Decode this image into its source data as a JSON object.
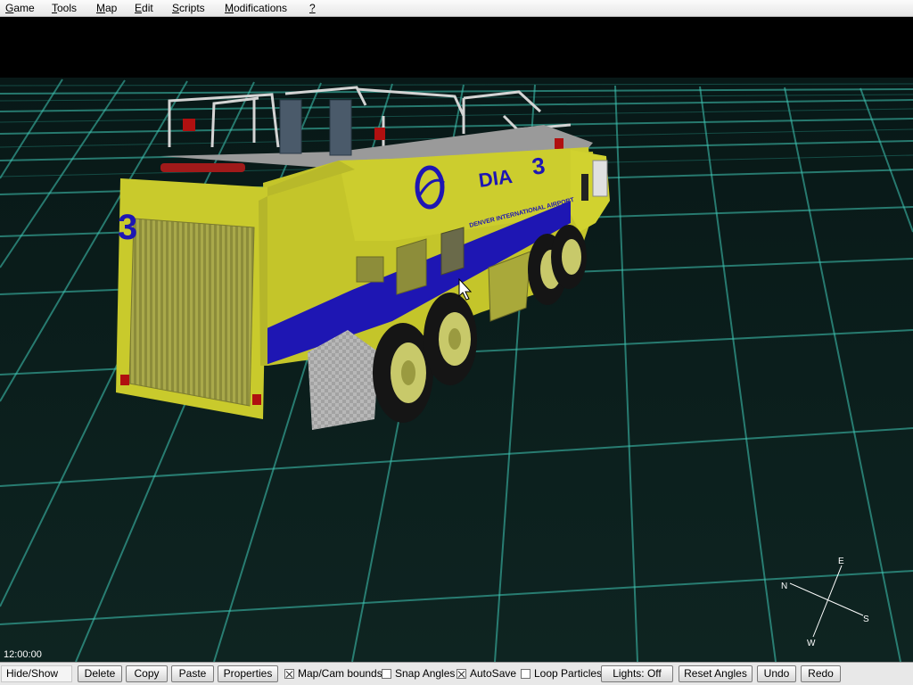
{
  "menu": {
    "items": [
      {
        "pre": "",
        "u": "G",
        "post": "ame"
      },
      {
        "pre": "",
        "u": "T",
        "post": "ools"
      },
      {
        "pre": "",
        "u": "M",
        "post": "ap"
      },
      {
        "pre": "",
        "u": "E",
        "post": "dit"
      },
      {
        "pre": "",
        "u": "S",
        "post": "cripts"
      },
      {
        "pre": "",
        "u": "M",
        "post": "odifications"
      },
      {
        "pre": "",
        "u": "?",
        "post": ""
      }
    ]
  },
  "scene": {
    "vehicle_text": {
      "operator": "DIA",
      "unit_number": "3",
      "airport_name": "DENVER INTERNATIONAL AIRPORT",
      "rear_number": "3"
    },
    "colors": {
      "ground_grid": "#35c7b7",
      "ground_fill": "#0a1a17",
      "truck_body": "#c7c828",
      "truck_stripe": "#1a14b0",
      "tire": "#151515"
    }
  },
  "time": "12:00:00",
  "compass": {
    "n": "N",
    "e": "E",
    "s": "S",
    "w": "W"
  },
  "toolbar": {
    "hide_show": "Hide/Show",
    "delete": "Delete",
    "copy": "Copy",
    "paste": "Paste",
    "properties": "Properties",
    "map_cam_bounds": {
      "label": "Map/Cam bounds",
      "checked": true
    },
    "snap_angles": {
      "label": "Snap Angles",
      "checked": false
    },
    "autosave": {
      "label": "AutoSave",
      "checked": true
    },
    "loop_particles": {
      "label": "Loop Particles",
      "checked": false
    },
    "lights": "Lights: Off",
    "reset_angles": "Reset Angles",
    "undo": "Undo",
    "redo": "Redo"
  }
}
